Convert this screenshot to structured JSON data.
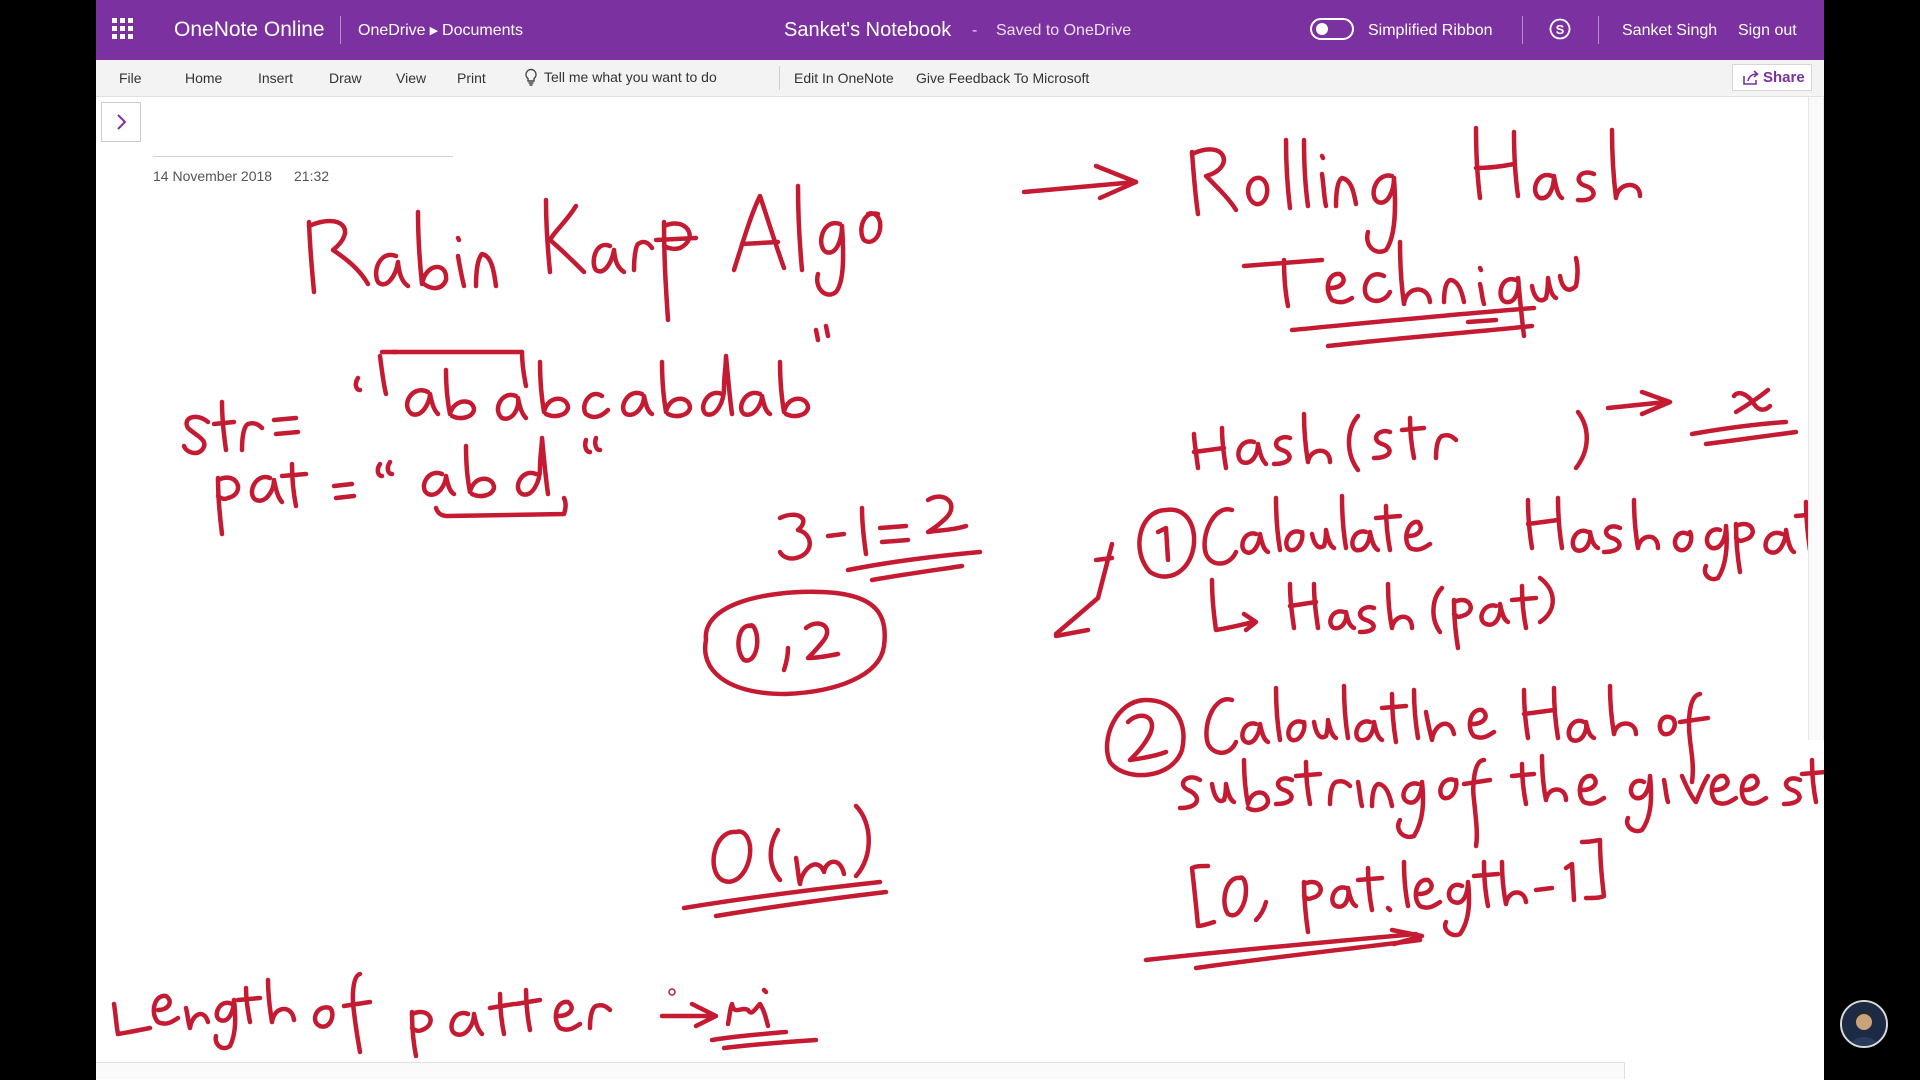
{
  "titlebar": {
    "app_name": "OneNote Online",
    "breadcrumb": [
      "OneDrive",
      "Documents"
    ],
    "notebook_name": "Sanket's Notebook",
    "separator": "-",
    "save_status": "Saved to OneDrive",
    "simplified_ribbon_label": "Simplified Ribbon",
    "simplified_ribbon_on": false,
    "user_name": "Sanket Singh",
    "sign_out": "Sign out",
    "brand_color": "#7B31A0"
  },
  "ribbon": {
    "tabs": [
      "File",
      "Home",
      "Insert",
      "Draw",
      "View",
      "Print"
    ],
    "tell_me": "Tell me what you want to do",
    "edit_in_onenote": "Edit In OneNote",
    "feedback": "Give Feedback To Microsoft",
    "share": "Share"
  },
  "page": {
    "date": "14 November 2018",
    "time": "21:32",
    "ink_color": "#C41B32",
    "handwriting": {
      "title": "Rabin Karp Algo",
      "technique": "Rolling Hash Technique",
      "str_line": "str = \"ababcabdab\"",
      "pat_line": "pat = \"abd\"",
      "calc": "3-1 = 2",
      "range": "0,2",
      "complexity": "O(m)",
      "pattern_length": "Length of pattern -> m",
      "hash_line": "Hash(str) -> x",
      "step1": "Calculate Hash of pat",
      "step1_sub": "-> Hash(pat)",
      "step2": "Calculate the Hash of substring of the given string",
      "step2_range": "[0, pat.length-1]"
    }
  }
}
